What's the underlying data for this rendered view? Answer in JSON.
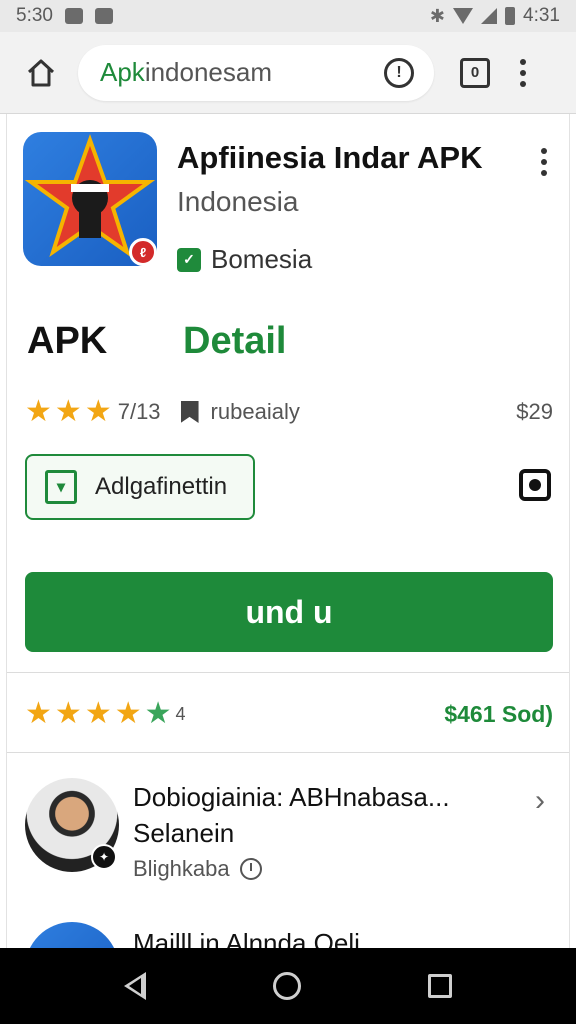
{
  "status_bar": {
    "time_left": "5:30",
    "time_right": "4:31"
  },
  "browser": {
    "url_highlight": "Apk",
    "url_rest": "indonesam",
    "tabs_count": "0"
  },
  "app": {
    "title": "Apfiinesia Indar APK",
    "subtitle": "Indonesia",
    "developer": "Bomesia",
    "badge": "ℓ"
  },
  "labels": {
    "apk": "APK",
    "detail": "Detail"
  },
  "meta": {
    "rating_count": "7/13",
    "category": "rubeaialy",
    "price": "$29"
  },
  "chip": {
    "label": "Adlgafinettin"
  },
  "install": {
    "label": "und u"
  },
  "rating": {
    "value": "4",
    "link": "$461 Sod)"
  },
  "review": {
    "title": "Dobiogiainia: ABHnabasa...",
    "subtitle": "Selanein",
    "meta": "Blighkaba"
  },
  "next_item": {
    "title": "Mailll in Alnnda Oeli"
  },
  "colors": {
    "accent": "#1e8a3a",
    "star": "#f2a614",
    "star_green": "#3aa55b"
  },
  "icons": [
    "home-icon",
    "info-icon",
    "tabs-icon",
    "more-vert-icon",
    "bookmark-icon",
    "scan-icon",
    "chevron-right-icon",
    "clock-icon",
    "nav-back-icon",
    "nav-home-icon",
    "nav-recents-icon"
  ]
}
